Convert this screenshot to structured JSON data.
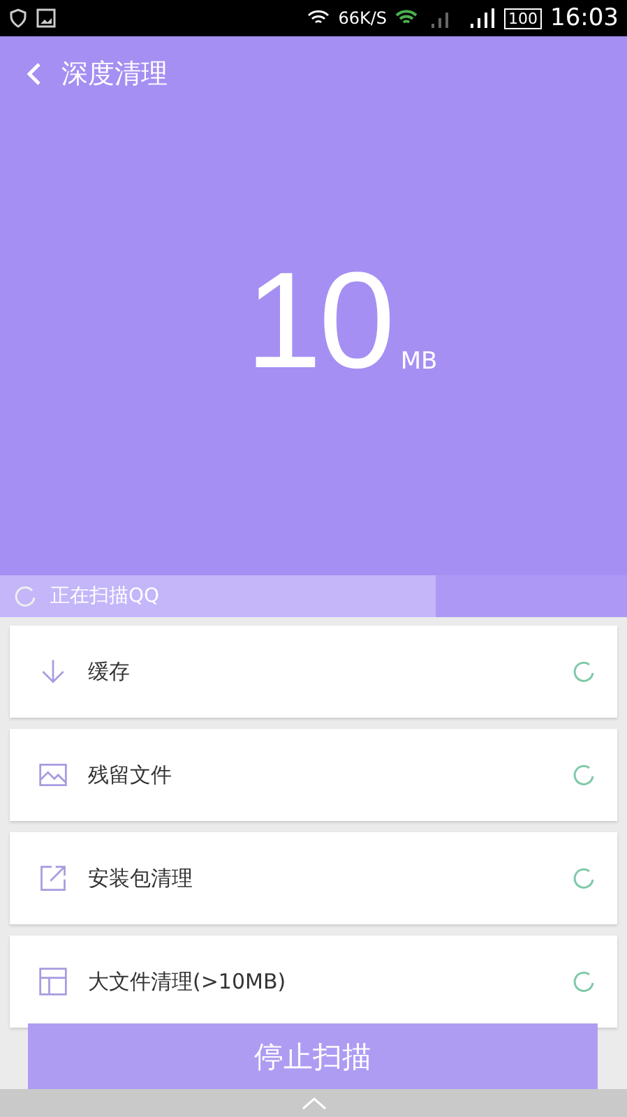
{
  "status_bar": {
    "speed": "66K/S",
    "battery": "100",
    "time": "16:03"
  },
  "header": {
    "title": "深度清理",
    "size": "10",
    "unit": "MB"
  },
  "progress": {
    "label": "正在扫描QQ",
    "level": 0.695
  },
  "items": [
    {
      "kind": "download",
      "label": "缓存"
    },
    {
      "kind": "image",
      "label": "残留文件"
    },
    {
      "kind": "export",
      "label": "安装包清理"
    },
    {
      "kind": "grid",
      "label": "大文件清理(>10MB)"
    }
  ],
  "stop_button": {
    "label": "停止扫描"
  }
}
